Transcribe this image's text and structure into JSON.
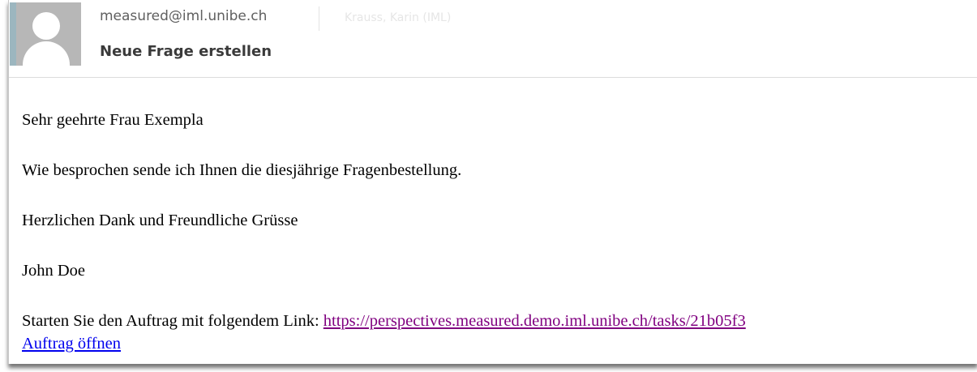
{
  "header": {
    "sender": "measured@iml.unibe.ch",
    "recipient": "Krauss, Karin (IML)",
    "subject": "Neue Frage erstellen"
  },
  "body": {
    "greeting": "Sehr geehrte Frau Exempla",
    "message": "Wie besprochen sende ich Ihnen die diesjährige Fragenbestellung.",
    "closing": "Herzlichen Dank und Freundliche Grüsse",
    "signature": "John Doe",
    "link_intro": "Starten Sie den Auftrag mit folgendem Link: ",
    "task_url": "https://perspectives.measured.demo.iml.unibe.ch/tasks/21b05f3",
    "open_link_label": "Auftrag öffnen"
  },
  "icons": {
    "avatar": "default-person-avatar-icon"
  },
  "colors": {
    "visited_link": "#800080",
    "link": "#0000ee",
    "avatar_bg": "#b7b7b7",
    "avatar_accent": "#9cb6bf"
  }
}
